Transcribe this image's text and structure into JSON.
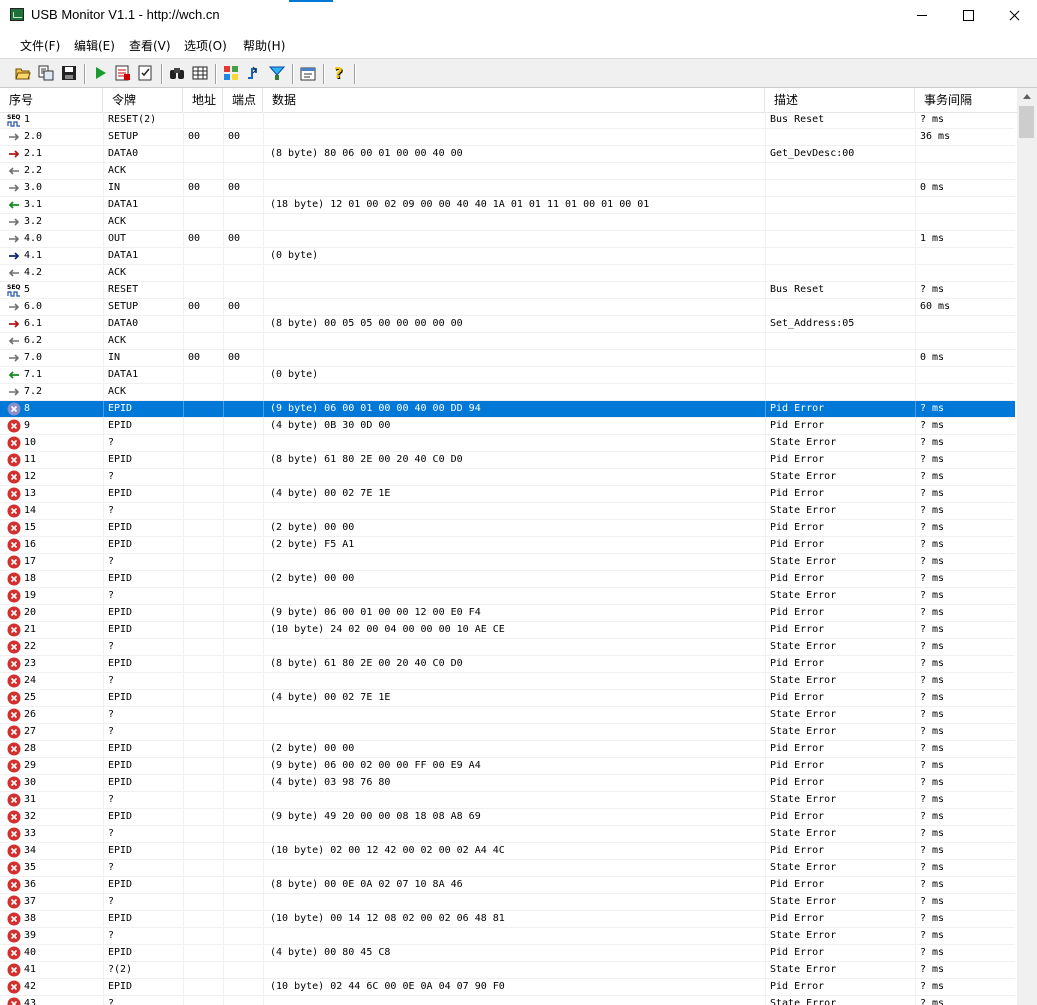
{
  "window": {
    "title": "USB Monitor V1.1 - http://wch.cn"
  },
  "menu": [
    "文件(F)",
    "编辑(E)",
    "查看(V)",
    "选项(O)",
    "帮助(H)"
  ],
  "toolbar": [
    "open-icon",
    "export-icon",
    "save-icon",
    "start-icon",
    "stop-icon",
    "edit-icon",
    "find-icon",
    "table-icon",
    "color-icon",
    "trigger-icon",
    "filter-icon",
    "properties-icon",
    "help-icon"
  ],
  "columns": [
    "序号",
    "令牌",
    "地址",
    "端点",
    "数据",
    "描述",
    "事务间隔"
  ],
  "colors": {
    "selection": "#0078d7",
    "error": "#d32f2f"
  },
  "rows": [
    {
      "icon": "seq",
      "seq": "1",
      "token": "RESET(2)",
      "addr": "",
      "ep": "",
      "data": "",
      "desc": "Bus Reset",
      "interval": "? ms"
    },
    {
      "icon": "gray",
      "seq": "2.0",
      "token": "SETUP",
      "addr": "00",
      "ep": "00",
      "data": "",
      "desc": "",
      "interval": "36 ms"
    },
    {
      "icon": "red",
      "seq": "2.1",
      "token": "DATA0",
      "addr": "",
      "ep": "",
      "data": "(8 byte) 80 06 00 01 00 00 40 00",
      "desc": "Get_DevDesc:00",
      "interval": ""
    },
    {
      "icon": "back",
      "seq": "2.2",
      "token": "ACK",
      "addr": "",
      "ep": "",
      "data": "",
      "desc": "",
      "interval": ""
    },
    {
      "icon": "gray",
      "seq": "3.0",
      "token": "IN",
      "addr": "00",
      "ep": "00",
      "data": "",
      "desc": "",
      "interval": "0 ms"
    },
    {
      "icon": "green",
      "seq": "3.1",
      "token": "DATA1",
      "addr": "",
      "ep": "",
      "data": "(18 byte) 12 01 00 02 09 00 00 40 40 1A 01 01 11 01 00 01 00 01",
      "desc": "",
      "interval": ""
    },
    {
      "icon": "gray",
      "seq": "3.2",
      "token": "ACK",
      "addr": "",
      "ep": "",
      "data": "",
      "desc": "",
      "interval": ""
    },
    {
      "icon": "gray",
      "seq": "4.0",
      "token": "OUT",
      "addr": "00",
      "ep": "00",
      "data": "",
      "desc": "",
      "interval": "1 ms"
    },
    {
      "icon": "blue",
      "seq": "4.1",
      "token": "DATA1",
      "addr": "",
      "ep": "",
      "data": "(0 byte)",
      "desc": "",
      "interval": ""
    },
    {
      "icon": "back",
      "seq": "4.2",
      "token": "ACK",
      "addr": "",
      "ep": "",
      "data": "",
      "desc": "",
      "interval": ""
    },
    {
      "icon": "seq",
      "seq": "5",
      "token": "RESET",
      "addr": "",
      "ep": "",
      "data": "",
      "desc": "Bus Reset",
      "interval": "? ms"
    },
    {
      "icon": "gray",
      "seq": "6.0",
      "token": "SETUP",
      "addr": "00",
      "ep": "00",
      "data": "",
      "desc": "",
      "interval": "60 ms"
    },
    {
      "icon": "red",
      "seq": "6.1",
      "token": "DATA0",
      "addr": "",
      "ep": "",
      "data": "(8 byte) 00 05 05 00 00 00 00 00",
      "desc": "Set_Address:05",
      "interval": ""
    },
    {
      "icon": "back",
      "seq": "6.2",
      "token": "ACK",
      "addr": "",
      "ep": "",
      "data": "",
      "desc": "",
      "interval": ""
    },
    {
      "icon": "gray",
      "seq": "7.0",
      "token": "IN",
      "addr": "00",
      "ep": "00",
      "data": "",
      "desc": "",
      "interval": "0 ms"
    },
    {
      "icon": "green",
      "seq": "7.1",
      "token": "DATA1",
      "addr": "",
      "ep": "",
      "data": "(0 byte)",
      "desc": "",
      "interval": ""
    },
    {
      "icon": "gray",
      "seq": "7.2",
      "token": "ACK",
      "addr": "",
      "ep": "",
      "data": "",
      "desc": "",
      "interval": ""
    },
    {
      "icon": "error",
      "seq": "8",
      "token": "EPID",
      "addr": "",
      "ep": "",
      "data": "(9 byte) 06 00 01 00 00 40 00 DD 94",
      "desc": "Pid Error",
      "interval": "? ms",
      "selected": true
    },
    {
      "icon": "error",
      "seq": "9",
      "token": "EPID",
      "addr": "",
      "ep": "",
      "data": "(4 byte) 0B 30 0D 00",
      "desc": "Pid Error",
      "interval": "? ms"
    },
    {
      "icon": "error",
      "seq": "10",
      "token": "?",
      "addr": "",
      "ep": "",
      "data": "",
      "desc": "State Error",
      "interval": "? ms"
    },
    {
      "icon": "error",
      "seq": "11",
      "token": "EPID",
      "addr": "",
      "ep": "",
      "data": "(8 byte) 61 80 2E 00 20 40 C0 D0",
      "desc": "Pid Error",
      "interval": "? ms"
    },
    {
      "icon": "error",
      "seq": "12",
      "token": "?",
      "addr": "",
      "ep": "",
      "data": "",
      "desc": "State Error",
      "interval": "? ms"
    },
    {
      "icon": "error",
      "seq": "13",
      "token": "EPID",
      "addr": "",
      "ep": "",
      "data": "(4 byte) 00 02 7E 1E",
      "desc": "Pid Error",
      "interval": "? ms"
    },
    {
      "icon": "error",
      "seq": "14",
      "token": "?",
      "addr": "",
      "ep": "",
      "data": "",
      "desc": "State Error",
      "interval": "? ms"
    },
    {
      "icon": "error",
      "seq": "15",
      "token": "EPID",
      "addr": "",
      "ep": "",
      "data": "(2 byte) 00 00",
      "desc": "Pid Error",
      "interval": "? ms"
    },
    {
      "icon": "error",
      "seq": "16",
      "token": "EPID",
      "addr": "",
      "ep": "",
      "data": "(2 byte) F5 A1",
      "desc": "Pid Error",
      "interval": "? ms"
    },
    {
      "icon": "error",
      "seq": "17",
      "token": "?",
      "addr": "",
      "ep": "",
      "data": "",
      "desc": "State Error",
      "interval": "? ms"
    },
    {
      "icon": "error",
      "seq": "18",
      "token": "EPID",
      "addr": "",
      "ep": "",
      "data": "(2 byte) 00 00",
      "desc": "Pid Error",
      "interval": "? ms"
    },
    {
      "icon": "error",
      "seq": "19",
      "token": "?",
      "addr": "",
      "ep": "",
      "data": "",
      "desc": "State Error",
      "interval": "? ms"
    },
    {
      "icon": "error",
      "seq": "20",
      "token": "EPID",
      "addr": "",
      "ep": "",
      "data": "(9 byte) 06 00 01 00 00 12 00 E0 F4",
      "desc": "Pid Error",
      "interval": "? ms"
    },
    {
      "icon": "error",
      "seq": "21",
      "token": "EPID",
      "addr": "",
      "ep": "",
      "data": "(10 byte) 24 02 00 04 00 00 00 10 AE CE",
      "desc": "Pid Error",
      "interval": "? ms"
    },
    {
      "icon": "error",
      "seq": "22",
      "token": "?",
      "addr": "",
      "ep": "",
      "data": "",
      "desc": "State Error",
      "interval": "? ms"
    },
    {
      "icon": "error",
      "seq": "23",
      "token": "EPID",
      "addr": "",
      "ep": "",
      "data": "(8 byte) 61 80 2E 00 20 40 C0 D0",
      "desc": "Pid Error",
      "interval": "? ms"
    },
    {
      "icon": "error",
      "seq": "24",
      "token": "?",
      "addr": "",
      "ep": "",
      "data": "",
      "desc": "State Error",
      "interval": "? ms"
    },
    {
      "icon": "error",
      "seq": "25",
      "token": "EPID",
      "addr": "",
      "ep": "",
      "data": "(4 byte) 00 02 7E 1E",
      "desc": "Pid Error",
      "interval": "? ms"
    },
    {
      "icon": "error",
      "seq": "26",
      "token": "?",
      "addr": "",
      "ep": "",
      "data": "",
      "desc": "State Error",
      "interval": "? ms"
    },
    {
      "icon": "error",
      "seq": "27",
      "token": "?",
      "addr": "",
      "ep": "",
      "data": "",
      "desc": "State Error",
      "interval": "? ms"
    },
    {
      "icon": "error",
      "seq": "28",
      "token": "EPID",
      "addr": "",
      "ep": "",
      "data": "(2 byte) 00 00",
      "desc": "Pid Error",
      "interval": "? ms"
    },
    {
      "icon": "error",
      "seq": "29",
      "token": "EPID",
      "addr": "",
      "ep": "",
      "data": "(9 byte) 06 00 02 00 00 FF 00 E9 A4",
      "desc": "Pid Error",
      "interval": "? ms"
    },
    {
      "icon": "error",
      "seq": "30",
      "token": "EPID",
      "addr": "",
      "ep": "",
      "data": "(4 byte) 03 98 76 80",
      "desc": "Pid Error",
      "interval": "? ms"
    },
    {
      "icon": "error",
      "seq": "31",
      "token": "?",
      "addr": "",
      "ep": "",
      "data": "",
      "desc": "State Error",
      "interval": "? ms"
    },
    {
      "icon": "error",
      "seq": "32",
      "token": "EPID",
      "addr": "",
      "ep": "",
      "data": "(9 byte) 49 20 00 00 08 18 08 A8 69",
      "desc": "Pid Error",
      "interval": "? ms"
    },
    {
      "icon": "error",
      "seq": "33",
      "token": "?",
      "addr": "",
      "ep": "",
      "data": "",
      "desc": "State Error",
      "interval": "? ms"
    },
    {
      "icon": "error",
      "seq": "34",
      "token": "EPID",
      "addr": "",
      "ep": "",
      "data": "(10 byte) 02 00 12 42 00 02 00 02 A4 4C",
      "desc": "Pid Error",
      "interval": "? ms"
    },
    {
      "icon": "error",
      "seq": "35",
      "token": "?",
      "addr": "",
      "ep": "",
      "data": "",
      "desc": "State Error",
      "interval": "? ms"
    },
    {
      "icon": "error",
      "seq": "36",
      "token": "EPID",
      "addr": "",
      "ep": "",
      "data": "(8 byte) 00 0E 0A 02 07 10 8A 46",
      "desc": "Pid Error",
      "interval": "? ms"
    },
    {
      "icon": "error",
      "seq": "37",
      "token": "?",
      "addr": "",
      "ep": "",
      "data": "",
      "desc": "State Error",
      "interval": "? ms"
    },
    {
      "icon": "error",
      "seq": "38",
      "token": "EPID",
      "addr": "",
      "ep": "",
      "data": "(10 byte) 00 14 12 08 02 00 02 06 48 81",
      "desc": "Pid Error",
      "interval": "? ms"
    },
    {
      "icon": "error",
      "seq": "39",
      "token": "?",
      "addr": "",
      "ep": "",
      "data": "",
      "desc": "State Error",
      "interval": "? ms"
    },
    {
      "icon": "error",
      "seq": "40",
      "token": "EPID",
      "addr": "",
      "ep": "",
      "data": "(4 byte) 00 80 45 C8",
      "desc": "Pid Error",
      "interval": "? ms"
    },
    {
      "icon": "error",
      "seq": "41",
      "token": "?(2)",
      "addr": "",
      "ep": "",
      "data": "",
      "desc": "State Error",
      "interval": "? ms"
    },
    {
      "icon": "error",
      "seq": "42",
      "token": "EPID",
      "addr": "",
      "ep": "",
      "data": "(10 byte) 02 44 6C 00 0E 0A 04 07 90 F0",
      "desc": "Pid Error",
      "interval": "? ms"
    },
    {
      "icon": "error",
      "seq": "43",
      "token": "?",
      "addr": "",
      "ep": "",
      "data": "",
      "desc": "State Error",
      "interval": "? ms"
    }
  ]
}
